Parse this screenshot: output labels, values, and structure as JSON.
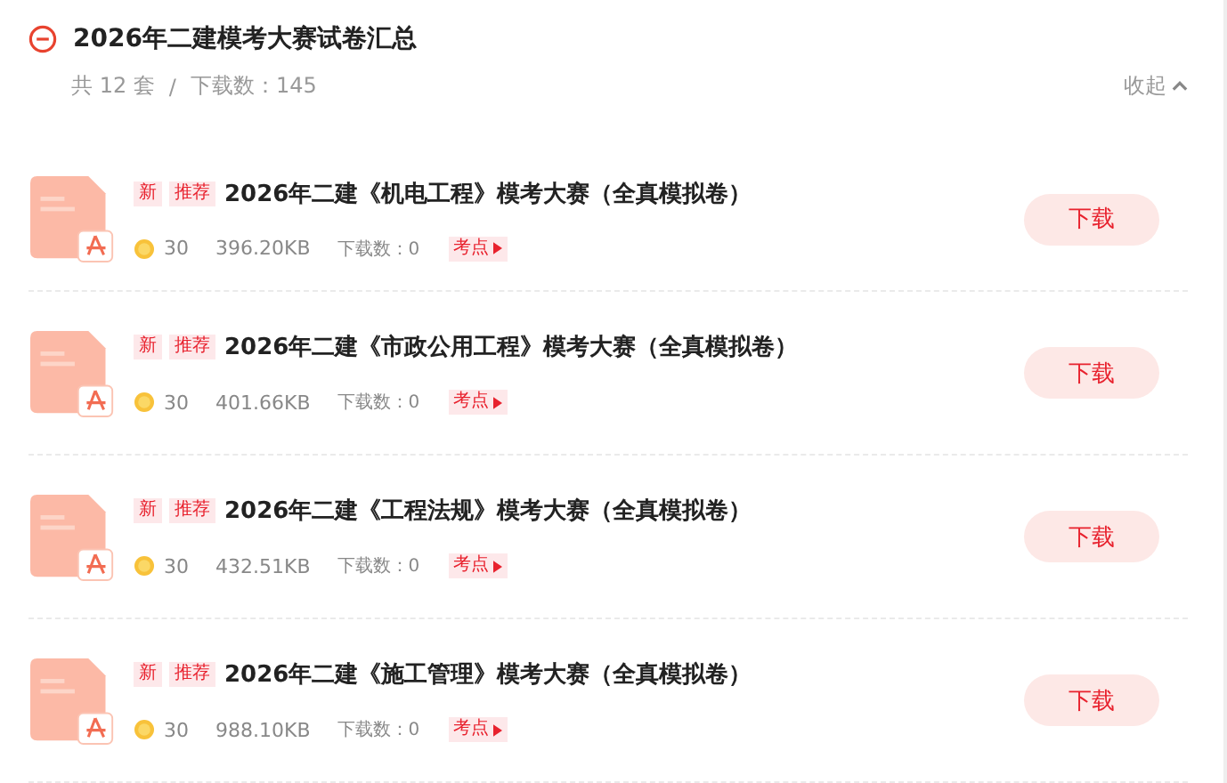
{
  "section": {
    "title": "2026年二建模考大赛试卷汇总",
    "expanded": true,
    "count": "共 12 套",
    "separator": "/",
    "downloads": "下载数：145",
    "collapse": "收起"
  },
  "files": [
    {
      "tags": [
        "新",
        "推荐"
      ],
      "title": "2026年二建《机电工程》模考大赛（全真模拟卷）",
      "coins": "30",
      "size": "396.20KB",
      "downloads": "下载数：0",
      "badge": "考点",
      "button": "下载"
    },
    {
      "tags": [
        "新",
        "推荐"
      ],
      "title": "2026年二建《市政公用工程》模考大赛（全真模拟卷）",
      "coins": "30",
      "size": "401.66KB",
      "downloads": "下载数：0",
      "badge": "考点",
      "button": "下载"
    },
    {
      "tags": [
        "新",
        "推荐"
      ],
      "title": "2026年二建《工程法规》模考大赛（全真模拟卷）",
      "coins": "30",
      "size": "432.51KB",
      "downloads": "下载数：0",
      "badge": "考点",
      "button": "下载"
    },
    {
      "tags": [
        "新",
        "推荐"
      ],
      "title": "2026年二建《施工管理》模考大赛（全真模拟卷）",
      "coins": "30",
      "size": "988.10KB",
      "downloads": "下载数：0",
      "badge": "考点",
      "button": "下载"
    }
  ]
}
